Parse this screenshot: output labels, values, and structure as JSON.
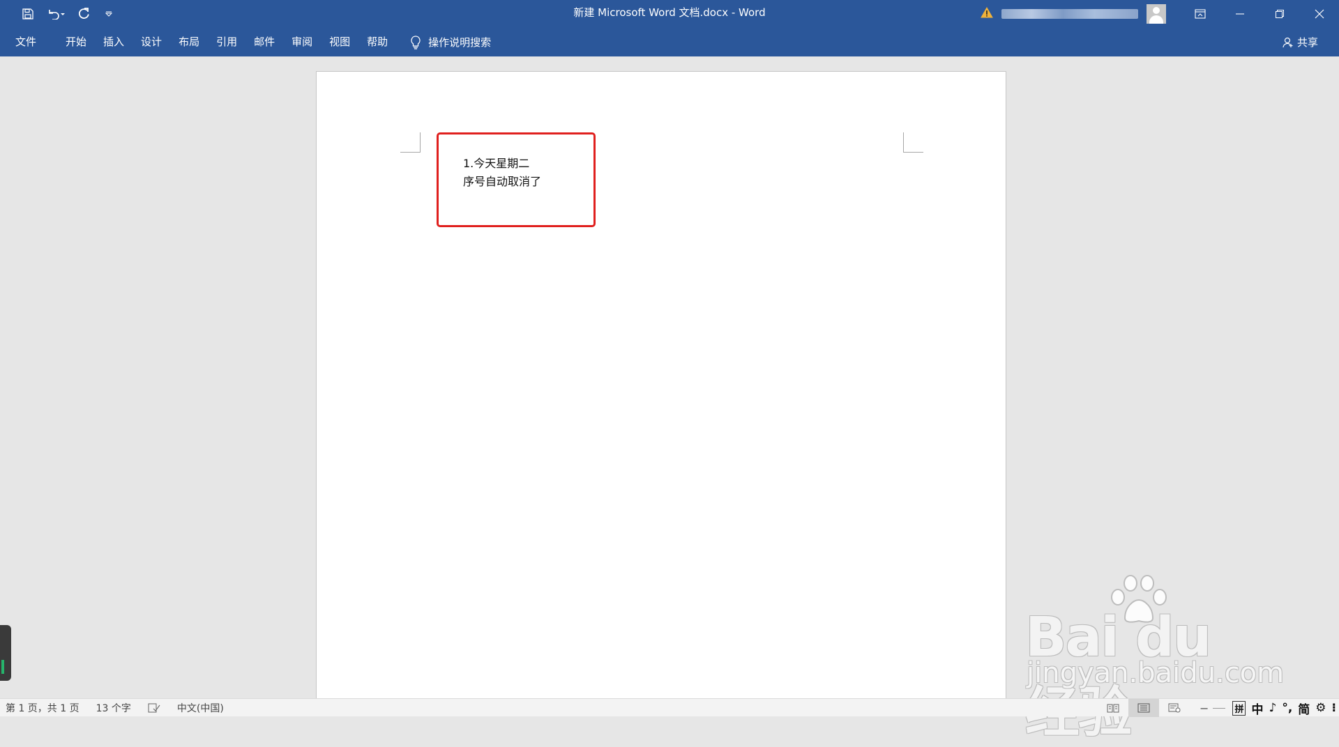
{
  "window": {
    "title": "新建 Microsoft Word 文档.docx  -  Word"
  },
  "quick_access": {
    "items": [
      "save-icon",
      "undo-icon",
      "redo-icon",
      "customize-icon"
    ]
  },
  "ribbon": {
    "tabs": [
      "文件",
      "开始",
      "插入",
      "设计",
      "布局",
      "引用",
      "邮件",
      "审阅",
      "视图",
      "帮助"
    ],
    "tell_me": "操作说明搜索",
    "share": "共享"
  },
  "document": {
    "lines": [
      "1.今天星期二",
      "序号自动取消了"
    ]
  },
  "status_bar": {
    "page": "第 1 页，共 1 页",
    "word_count": "13 个字",
    "language": "中文(中国)",
    "ime": [
      "拼",
      "中",
      "♪",
      "°,",
      "简",
      "⚙",
      "⁝"
    ]
  },
  "watermark": {
    "brand": "Bai du 经验",
    "url": "jingyan.baidu.com"
  },
  "colors": {
    "title_bar": "#2b579a",
    "highlight_box": "#e0201e",
    "canvas": "#e6e6e6"
  }
}
